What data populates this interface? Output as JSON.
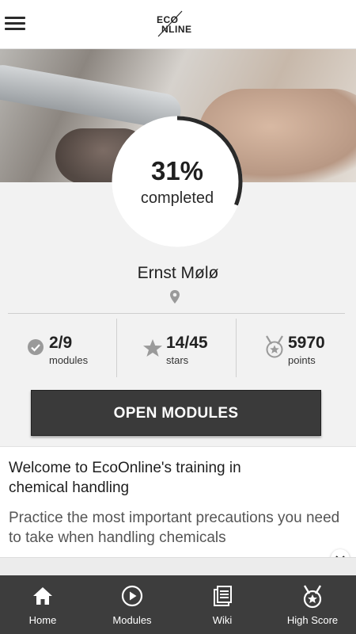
{
  "header": {
    "logo_top": "ECO",
    "logo_bottom": "NLINE",
    "logo_text": "EcoOnline",
    "menu_icon": "hamburger-menu-icon"
  },
  "progress": {
    "value": 0.31,
    "percent_text": "31%",
    "label": "completed",
    "ring_color": "#2a2a2a"
  },
  "user": {
    "name": "Ernst Mølø",
    "location_icon": "location-pin-icon"
  },
  "stats": [
    {
      "value": "2/9",
      "label": "modules",
      "icon": "check-circle-icon"
    },
    {
      "value": "14/45",
      "label": "stars",
      "icon": "star-icon"
    },
    {
      "value": "5970",
      "label": "points",
      "icon": "medal-icon"
    }
  ],
  "actions": {
    "open_modules": "OPEN MODULES"
  },
  "welcome": {
    "title": "Welcome to EcoOnline's training in chemical handling",
    "body": "Practice the most important precautions you need to take when handling chemicals"
  },
  "tabs": [
    {
      "label": "Home",
      "icon": "home-icon"
    },
    {
      "label": "Modules",
      "icon": "play-circle-icon"
    },
    {
      "label": "Wiki",
      "icon": "book-icon"
    },
    {
      "label": "High Score",
      "icon": "medal-icon"
    }
  ],
  "colors": {
    "tabbar_bg": "#3d3d3d",
    "button_bg": "#3a3a3a",
    "background": "#f2f2f2"
  }
}
